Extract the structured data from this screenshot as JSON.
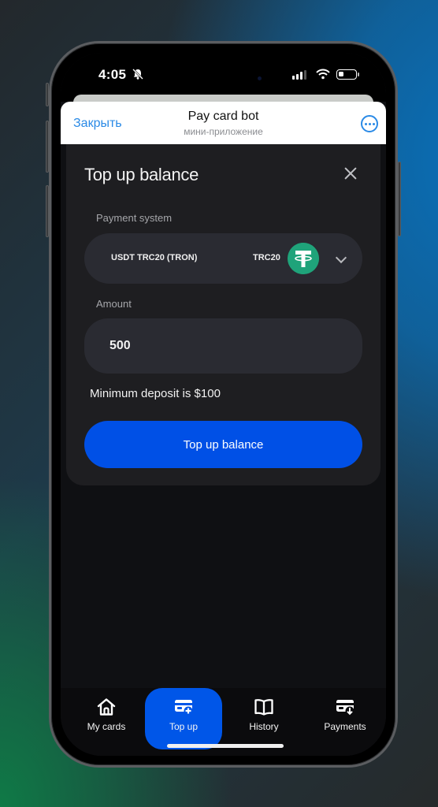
{
  "status_bar": {
    "time": "4:05",
    "silent_icon": "bell-slash-icon",
    "signal_icon": "cellular-signal-icon",
    "wifi_icon": "wifi-icon",
    "battery_icon": "battery-low-icon"
  },
  "telegram_header": {
    "close_label": "Закрыть",
    "title": "Pay card bot",
    "subtitle": "мини-приложение",
    "more_icon": "ellipsis-circle-icon"
  },
  "topup_card": {
    "title": "Top up balance",
    "close_icon": "close-icon",
    "payment_system": {
      "label": "Payment system",
      "selected_name": "USDT TRC20 (TRON)",
      "selected_network": "TRC20",
      "coin_icon": "tether-icon",
      "dropdown_icon": "chevron-down-icon"
    },
    "amount": {
      "label": "Amount",
      "value": "500"
    },
    "min_deposit_note": "Minimum deposit is $100",
    "submit_label": "Top up balance"
  },
  "tab_bar": {
    "items": [
      {
        "label": "My cards",
        "icon": "home-icon",
        "active": false
      },
      {
        "label": "Top up",
        "icon": "card-plus-icon",
        "active": true
      },
      {
        "label": "History",
        "icon": "book-icon",
        "active": false
      },
      {
        "label": "Payments",
        "icon": "card-download-icon",
        "active": false
      }
    ]
  },
  "colors": {
    "accent": "#0056e8",
    "telegram_link": "#2a8ae6",
    "tether_green": "#1fa37a",
    "card_bg": "#1e1e21",
    "field_bg": "#2a2b32"
  }
}
